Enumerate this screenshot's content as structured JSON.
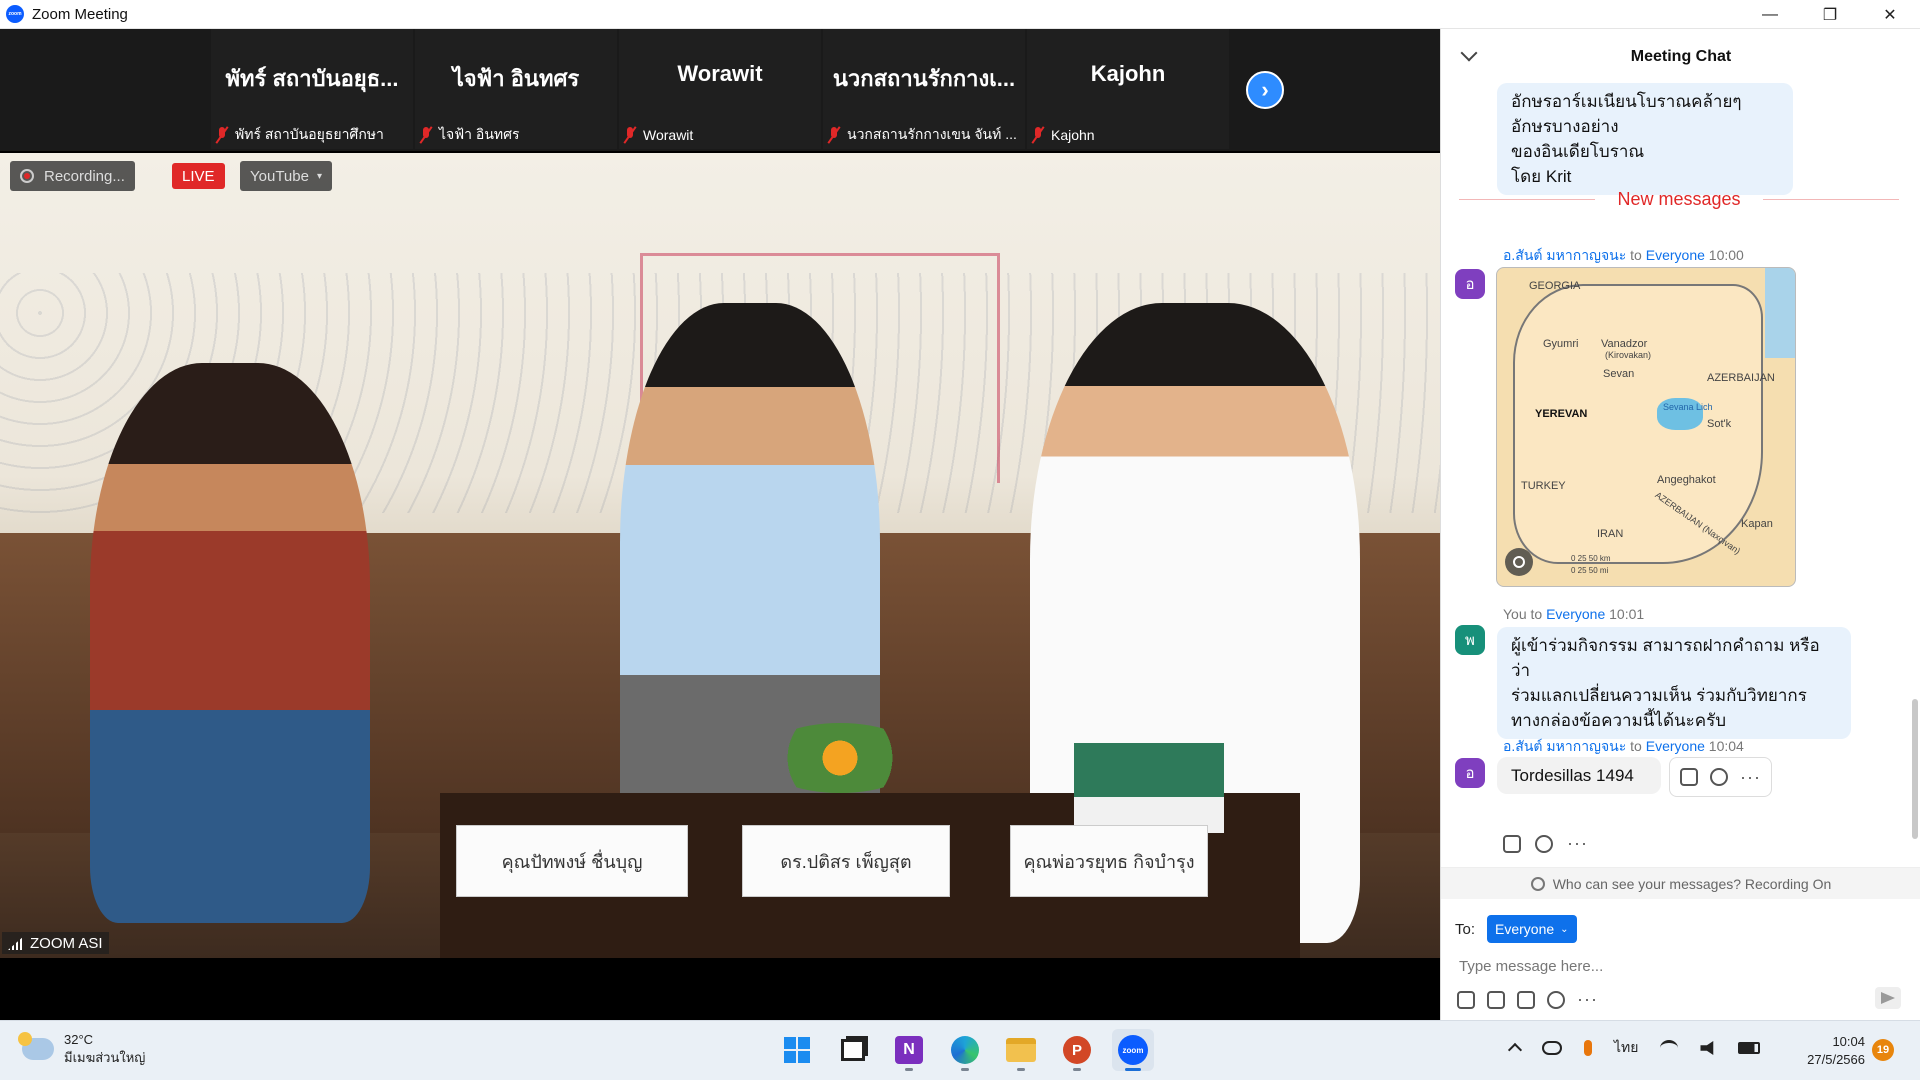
{
  "window": {
    "title": "Zoom Meeting",
    "minimize": "—",
    "maximize": "❐",
    "close": "✕"
  },
  "gallery": {
    "tiles": [
      {
        "name": "พัทร์ สถาบันอยุธ...",
        "label": "พัทร์ สถาบันอยุธยาศึกษา"
      },
      {
        "name": "ไจฟ้า อินทศร",
        "label": "ไจฟ้า อินทศร"
      },
      {
        "name": "Worawit",
        "label": "Worawit"
      },
      {
        "name": "นวกสถานรักกางเ...",
        "label": "นวกสถานรักกางเขน จันท์ ..."
      },
      {
        "name": "Kajohn",
        "label": "Kajohn"
      }
    ],
    "next_symbol": "›"
  },
  "video": {
    "recording_label": "Recording...",
    "live_label": "LIVE",
    "youtube_label": "YouTube",
    "youtube_caret": "▾",
    "speaker_label": "ZOOM ASI",
    "nameplates": [
      "คุณปัทพงษ์ ชื่นบุญ",
      "ดร.ปติสร เพ็ญสุต",
      "คุณพ่อวรยุทธ กิจบำรุง"
    ]
  },
  "chat": {
    "title": "Meeting Chat",
    "prev_message": {
      "lines": [
        "อักษรอาร์เมเนียนโบราณคล้ายๆอักษรบางอย่าง",
        "ของอินเดียโบราณ",
        "โดย Krit"
      ]
    },
    "new_messages_label": "New messages",
    "messages": [
      {
        "sender": "อ.สันต์ มหากาญจนะ",
        "to_word": "to",
        "recipient": "Everyone",
        "time": "10:00",
        "avatar": "อ"
      },
      {
        "sender": "You",
        "to_word": "to",
        "recipient": "Everyone",
        "time": "10:01",
        "avatar": "พ",
        "lines": [
          "ผู้เข้าร่วมกิจกรรม สามารถฝากคำถาม หรือว่า",
          "ร่วมแลกเปลี่ยนความเห็น ร่วมกับวิทยากร",
          "ทางกล่องข้อความนี้ได้นะครับ"
        ]
      },
      {
        "sender": "อ.สันต์ มหากาญจนะ",
        "to_word": "to",
        "recipient": "Everyone",
        "time": "10:04",
        "avatar": "อ",
        "text": "Tordesillas 1494"
      }
    ],
    "map_labels": {
      "georgia": "GEORGIA",
      "gyumri": "Gyumri",
      "vanadzor": "Vanadzor",
      "kirovakan": "(Kirovakan)",
      "sevan": "Sevan",
      "azerbaijan": "AZERBAIJAN",
      "yerevan": "YEREVAN",
      "sevana": "Sevana Lich",
      "sotk": "Sot'k",
      "angeghakot": "Angeghakot",
      "turkey": "TURKEY",
      "iran": "IRAN",
      "kapan": "Kapan",
      "azerbaijan_nax": "AZERBAIJAN (Naxçıvan)",
      "scale_km": "0  25  50 km",
      "scale_mi": "0   25   50 mi"
    },
    "more_dots": "···",
    "visibility_text": "Who can see your messages? Recording On",
    "to_label": "To:",
    "to_value": "Everyone",
    "to_caret": "⌄",
    "input_placeholder": "Type message here..."
  },
  "taskbar": {
    "temperature": "32°C",
    "weather_desc": "มีเมฆส่วนใหญ่",
    "onenote_letter": "N",
    "ppt_letter": "P",
    "zoom_text": "zoom",
    "language": "ไทย",
    "time": "10:04",
    "date": "27/5/2566",
    "notifications": "19"
  }
}
